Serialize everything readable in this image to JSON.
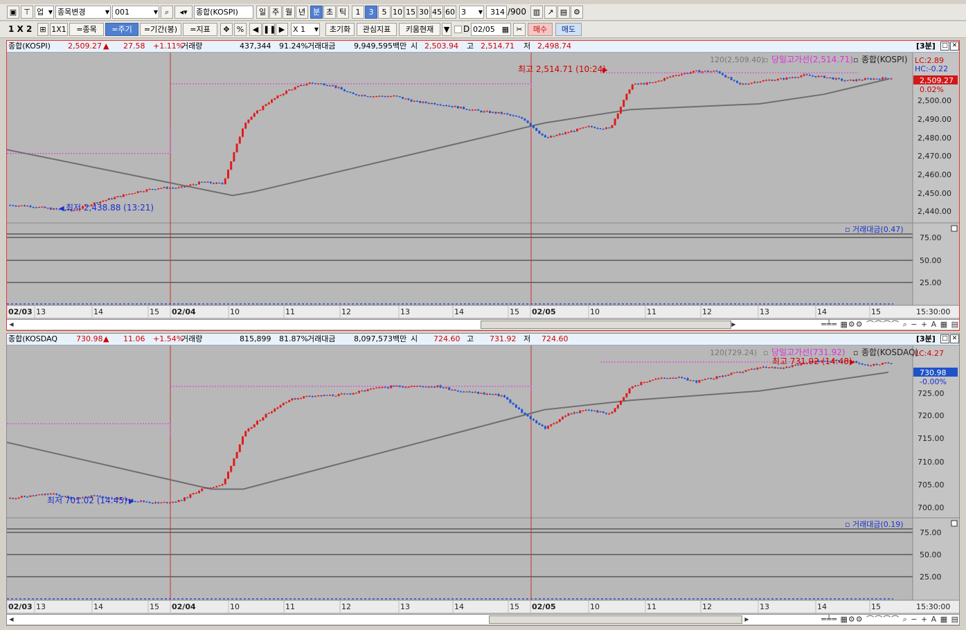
{
  "toolbar1": {
    "type_select": "업",
    "mode_select": "종목변경",
    "code_input": "001",
    "name_field": "종합(KOSPI)",
    "periods": [
      "일",
      "주",
      "월",
      "년",
      "분",
      "초",
      "틱"
    ],
    "active_period": "분",
    "minutes": [
      "1",
      "3",
      "5",
      "10",
      "15",
      "30",
      "45",
      "60"
    ],
    "active_minute": "3",
    "interval_value": "3",
    "count_value": "314",
    "count_max": "/900"
  },
  "toolbar2": {
    "layout_label": "1 X 2",
    "single_label": "1X1",
    "buttons": [
      "=종목",
      "=주기",
      "=기간(봉)",
      "=지표"
    ],
    "active_button": "=주기",
    "percent_label": "%",
    "scale_value": "X 1",
    "reset_label": "초기화",
    "interest_label": "관심지표",
    "kiwoom_label": "키움현재",
    "date_check_label": "D",
    "date_value": "02/05",
    "buy_label": "매수",
    "sell_label": "매도"
  },
  "colors": {
    "up": "#e21b1b",
    "down": "#1b54d8",
    "ma": "#6e6e6e",
    "high_line": "#e030e0",
    "chart_bg": "#b8b8b8",
    "header_bg": "#e9f2fb"
  },
  "panes": [
    {
      "name": "종합(KOSPI)",
      "price": "2,509.27",
      "arrow": "▲",
      "change": "27.58",
      "pct": "+1.11%",
      "vol_label": "거래량",
      "volume": "437,344",
      "vol_pct": "91.24%",
      "amt_label": "거래대금",
      "amount": "9,949,595백만",
      "open_label": "시",
      "open": "2,503.94",
      "high_label": "고",
      "high": "2,514.71",
      "low_label": "저",
      "low": "2,498.74",
      "interval_badge": "[3분]",
      "ma_label": "120(2,509.40)",
      "high_line_label": "당일고가선(2,514.71)",
      "legend_label": "종합(KOSPI)",
      "lc_label": "LC:2.89",
      "hc_label": "HC:-0.22",
      "cur_label": "2,509.27",
      "cur_pct": "0.02%",
      "high_marker": "최고 2,514.71 (10:24)",
      "low_marker": "최저 2,438.88 (13:21)",
      "amt_indicator": "거래대금(0.47)",
      "yaxis": [
        "2,500.00",
        "2,490.00",
        "2,480.00",
        "2,470.00",
        "2,460.00",
        "2,450.00",
        "2,440.00"
      ],
      "amt_axis": [
        "75.00",
        "50.00",
        "25.00"
      ],
      "xaxis": [
        "02/03",
        "13",
        "14",
        "15",
        "02/04",
        "10",
        "11",
        "12",
        "13",
        "14",
        "15",
        "02/05",
        "10",
        "11",
        "12",
        "13",
        "14",
        "15"
      ],
      "time_label": "15:30:00",
      "chart_data": {
        "type": "candlestick",
        "y_unit": "index points",
        "ylim": [
          2433,
          2520
        ],
        "days": [
          "02/03",
          "02/04",
          "02/05"
        ],
        "prev_day_high": [
          2469,
          2505.5
        ],
        "path": [
          [
            0,
            2442
          ],
          [
            1,
            2441.5
          ],
          [
            2,
            2440
          ],
          [
            3,
            2439
          ],
          [
            4,
            2443
          ],
          [
            5,
            2446
          ],
          [
            6,
            2449
          ],
          [
            7,
            2451
          ],
          [
            8,
            2451
          ],
          [
            9,
            2454
          ],
          [
            10,
            2453
          ],
          [
            11,
            2485
          ],
          [
            12,
            2495
          ],
          [
            13,
            2502
          ],
          [
            14,
            2506
          ],
          [
            15,
            2505
          ],
          [
            16,
            2500
          ],
          [
            17,
            2499
          ],
          [
            18,
            2499
          ],
          [
            19,
            2496
          ],
          [
            20,
            2495
          ],
          [
            21,
            2493
          ],
          [
            22,
            2491
          ],
          [
            23,
            2490
          ],
          [
            24,
            2487
          ],
          [
            25,
            2477
          ],
          [
            26,
            2480
          ],
          [
            27,
            2483
          ],
          [
            28,
            2482
          ],
          [
            29,
            2505
          ],
          [
            30,
            2506
          ],
          [
            31,
            2510
          ],
          [
            32,
            2512
          ],
          [
            33,
            2512
          ],
          [
            34,
            2505
          ],
          [
            35,
            2507
          ],
          [
            36,
            2508
          ],
          [
            37,
            2510
          ],
          [
            38,
            2509
          ],
          [
            39,
            2507
          ],
          [
            40,
            2508
          ],
          [
            41,
            2508.5
          ]
        ],
        "ma": [
          [
            0,
            2471
          ],
          [
            10.5,
            2447
          ],
          [
            11.5,
            2449
          ],
          [
            25,
            2485
          ],
          [
            29,
            2492
          ],
          [
            35,
            2495
          ],
          [
            38,
            2500
          ],
          [
            41,
            2508
          ]
        ]
      }
    },
    {
      "name": "종합(KOSDAQ",
      "price": "730.98",
      "arrow": "▲",
      "change": "11.06",
      "pct": "+1.54%",
      "vol_label": "거래량",
      "volume": "815,899",
      "vol_pct": "81.87%",
      "amt_label": "거래대금",
      "amount": "8,097,573백만",
      "open_label": "시",
      "open": "724.60",
      "high_label": "고",
      "high": "731.92",
      "low_label": "저",
      "low": "724.60",
      "interval_badge": "[3분]",
      "ma_label": "120(729.24)",
      "high_line_label": "당일고가선(731.92)",
      "legend_label": "종합(KOSDAQ)",
      "lc_label": "LC:4.27",
      "hc_label": "",
      "cur_label": "730.98",
      "cur_pct": "-0.00%",
      "high_marker": "최고 731.92 (14:48)",
      "low_marker": "최저 701.02 (14:45)",
      "amt_indicator": "거래대금(0.19)",
      "yaxis": [
        "725.00",
        "720.00",
        "715.00",
        "710.00",
        "705.00",
        "700.00"
      ],
      "amt_axis": [
        "75.00",
        "50.00",
        "25.00"
      ],
      "xaxis": [
        "02/03",
        "13",
        "14",
        "15",
        "02/04",
        "10",
        "11",
        "12",
        "13",
        "14",
        "15",
        "02/05",
        "10",
        "11",
        "12",
        "13",
        "14",
        "15"
      ],
      "time_label": "15:30:00",
      "chart_data": {
        "type": "candlestick",
        "y_unit": "index points",
        "ylim": [
          698,
          734
        ],
        "days": [
          "02/03",
          "02/04",
          "02/05"
        ],
        "prev_day_high": [
          718,
          726
        ],
        "path": [
          [
            0,
            702
          ],
          [
            1,
            702.5
          ],
          [
            2,
            703
          ],
          [
            3,
            702
          ],
          [
            4,
            702.5
          ],
          [
            5,
            702
          ],
          [
            6,
            701.5
          ],
          [
            7,
            701
          ],
          [
            8,
            701.5
          ],
          [
            9,
            704
          ],
          [
            10,
            705
          ],
          [
            11,
            716
          ],
          [
            12,
            720
          ],
          [
            13,
            723
          ],
          [
            14,
            724
          ],
          [
            15,
            724
          ],
          [
            16,
            724.5
          ],
          [
            17,
            725.5
          ],
          [
            18,
            726
          ],
          [
            19,
            726
          ],
          [
            20,
            726
          ],
          [
            21,
            725
          ],
          [
            22,
            724.5
          ],
          [
            23,
            724
          ],
          [
            24,
            720
          ],
          [
            25,
            717
          ],
          [
            26,
            720
          ],
          [
            27,
            721
          ],
          [
            28,
            720
          ],
          [
            29,
            726
          ],
          [
            30,
            727.5
          ],
          [
            31,
            728
          ],
          [
            32,
            727
          ],
          [
            33,
            728
          ],
          [
            34,
            729
          ],
          [
            35,
            730
          ],
          [
            36,
            730
          ],
          [
            37,
            731
          ],
          [
            38,
            731.5
          ],
          [
            39,
            731.5
          ],
          [
            40,
            730.5
          ],
          [
            41,
            731
          ]
        ],
        "ma": [
          [
            0,
            714
          ],
          [
            9.5,
            704
          ],
          [
            11,
            704
          ],
          [
            25,
            721
          ],
          [
            29,
            723
          ],
          [
            35,
            725
          ],
          [
            38,
            727
          ],
          [
            41,
            729
          ]
        ]
      }
    }
  ]
}
